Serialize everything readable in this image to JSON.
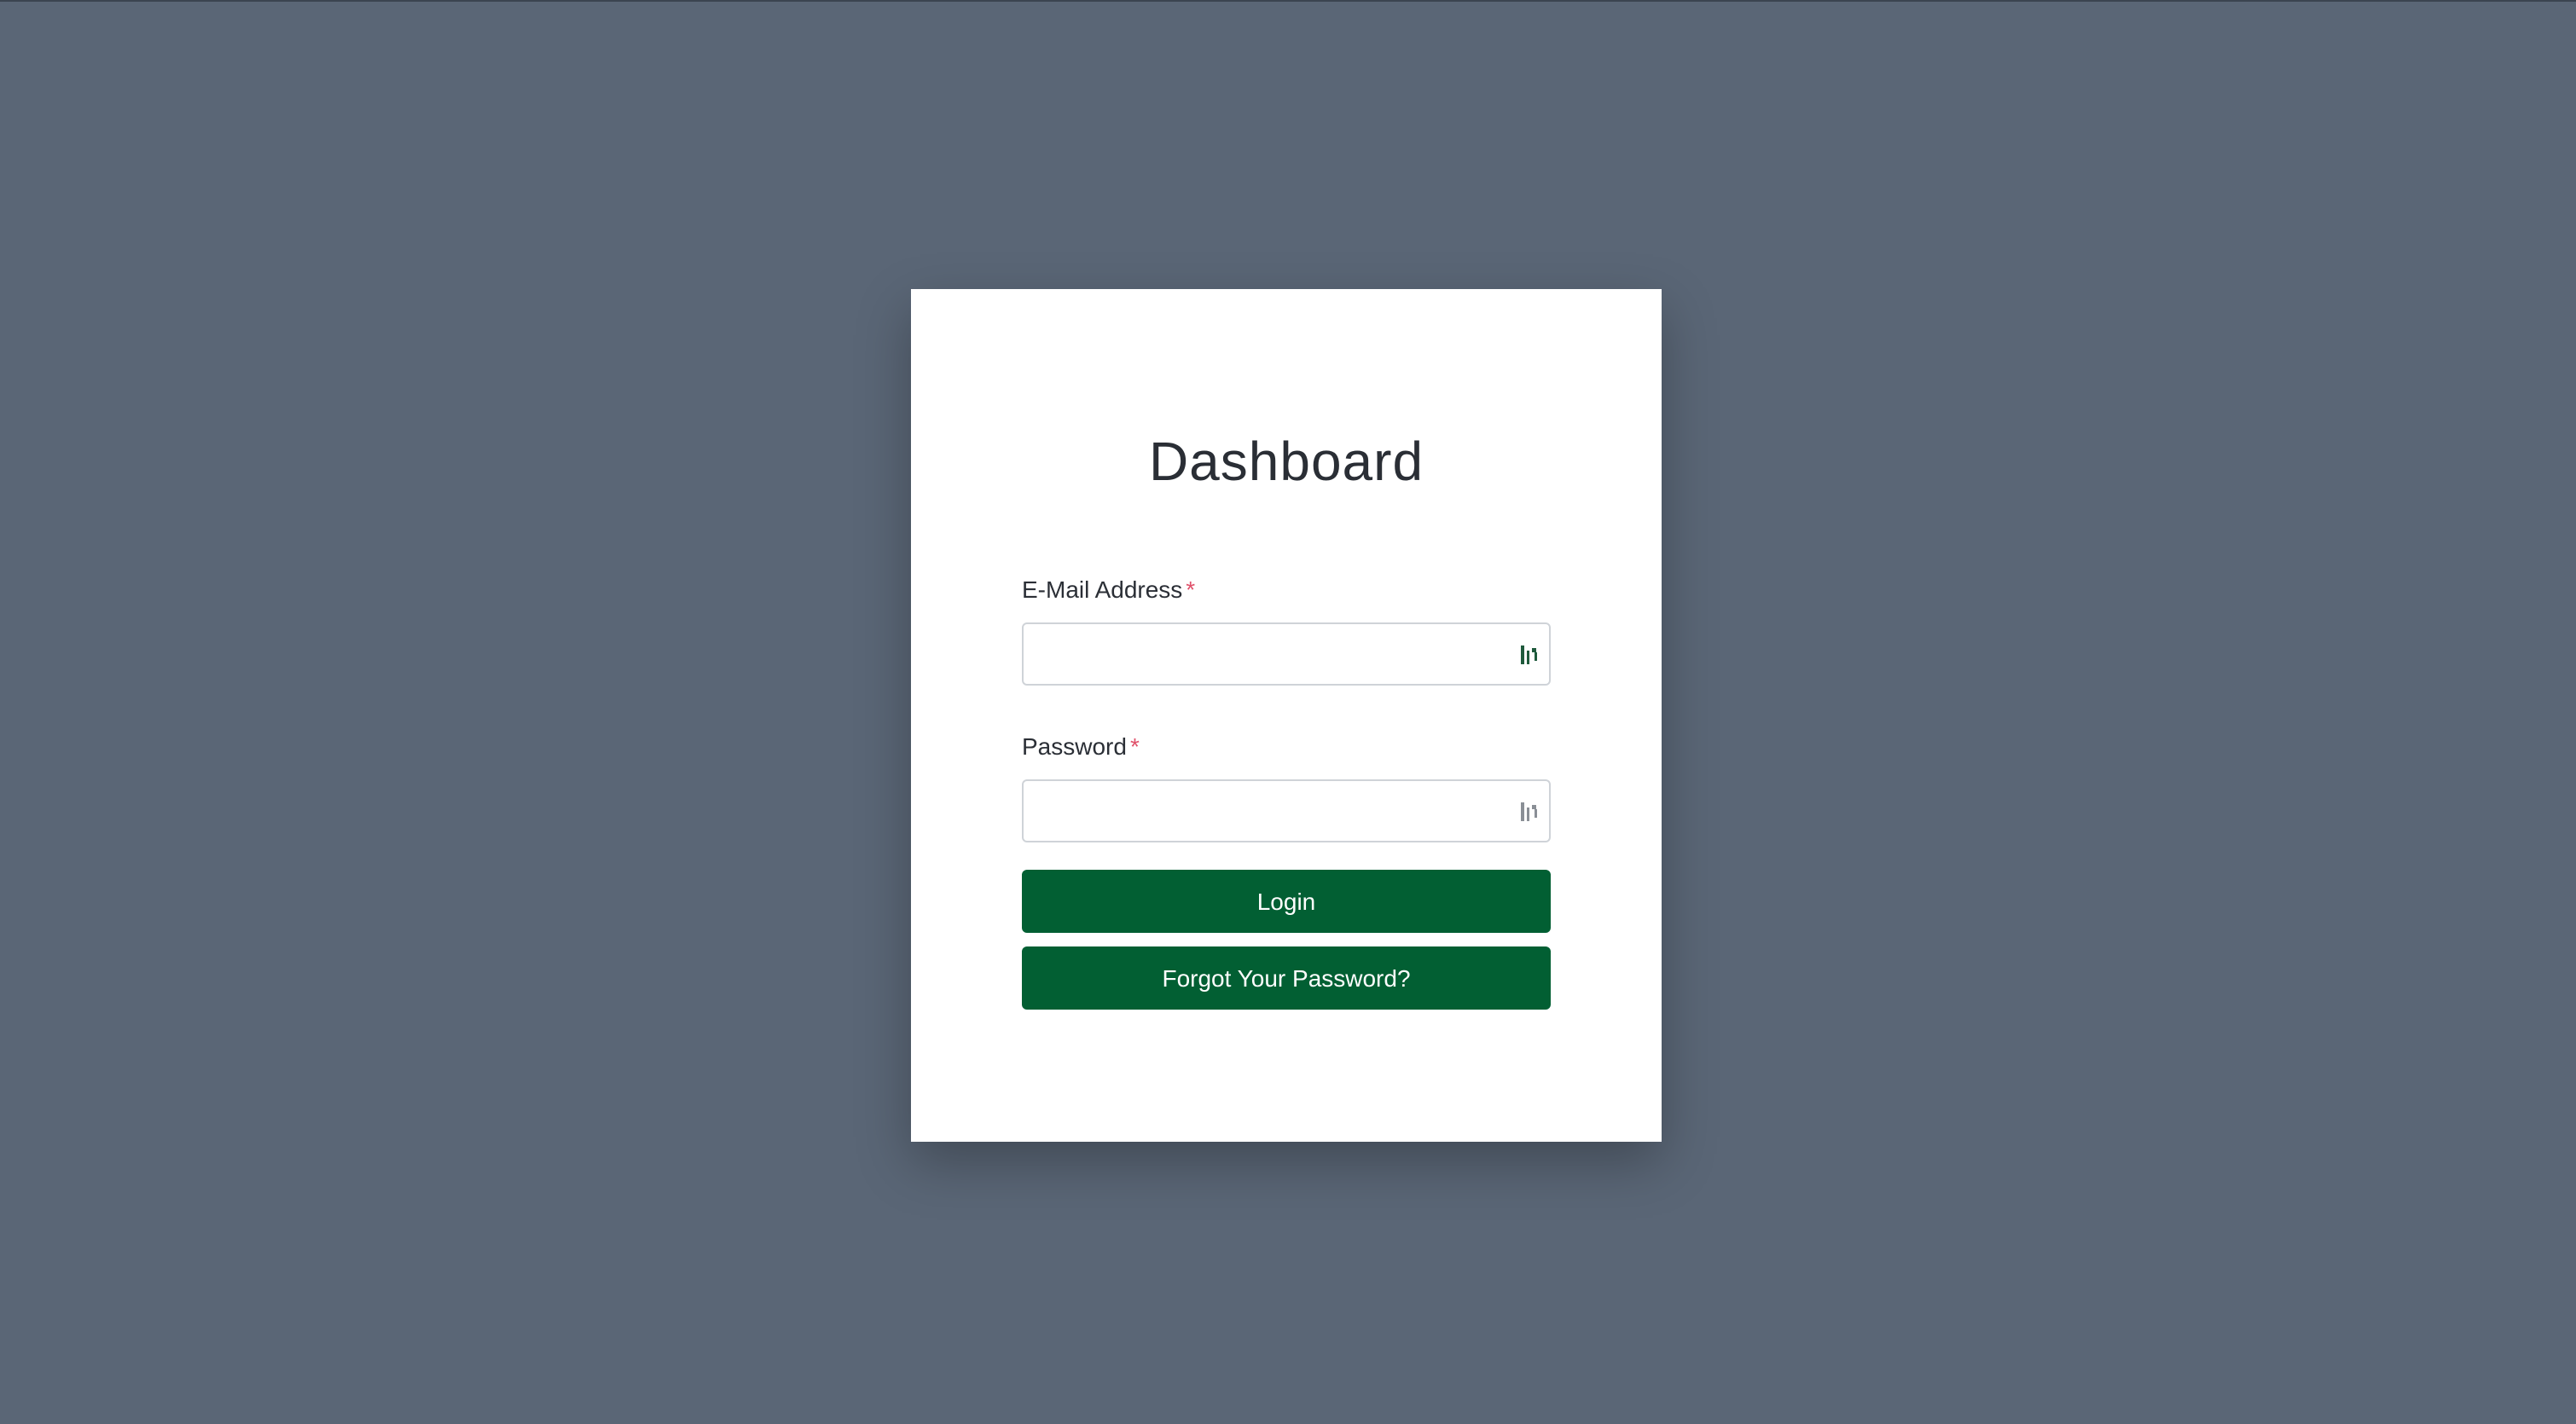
{
  "page": {
    "title": "Dashboard"
  },
  "form": {
    "email_label": "E-Mail Address",
    "email_required": "*",
    "email_value": "",
    "password_label": "Password",
    "password_required": "*",
    "password_value": "",
    "login_button": "Login",
    "forgot_button": "Forgot Your Password?"
  },
  "icons": {
    "email_field_icon": "password-manager-icon",
    "password_field_icon": "password-manager-icon"
  },
  "colors": {
    "background": "#5a6676",
    "card": "#ffffff",
    "primary_button": "#025f33",
    "required_marker": "#e0516a",
    "email_icon": "#1f5a3c",
    "password_icon": "#8a8f96"
  }
}
